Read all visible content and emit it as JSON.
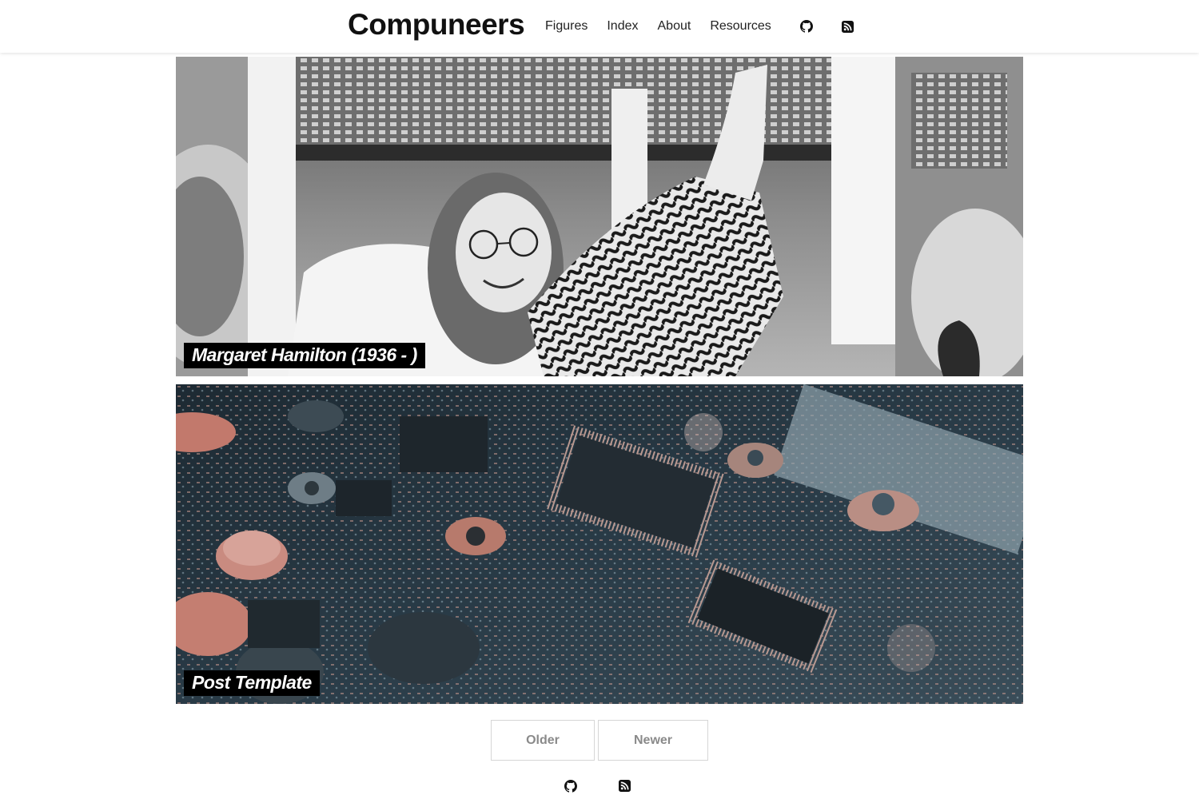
{
  "site": {
    "title": "Compuneers"
  },
  "nav": {
    "items": [
      {
        "label": "Figures"
      },
      {
        "label": "Index"
      },
      {
        "label": "About"
      },
      {
        "label": "Resources"
      }
    ],
    "icons": [
      "github-icon",
      "rss-icon"
    ]
  },
  "posts": [
    {
      "title": "Margaret Hamilton (1936 - )",
      "image": "black-and-white photo of woman smiling in cockpit"
    },
    {
      "title": "Post Template",
      "image": "close-up of circuit board"
    }
  ],
  "pagination": {
    "older_label": "Older",
    "newer_label": "Newer"
  },
  "footer": {
    "icons": [
      "github-icon",
      "rss-icon"
    ]
  },
  "colors": {
    "title_bg": "#000000",
    "title_text": "#ffffff",
    "pager_text": "#8a8a8a",
    "pager_border": "#d6d6d6"
  }
}
